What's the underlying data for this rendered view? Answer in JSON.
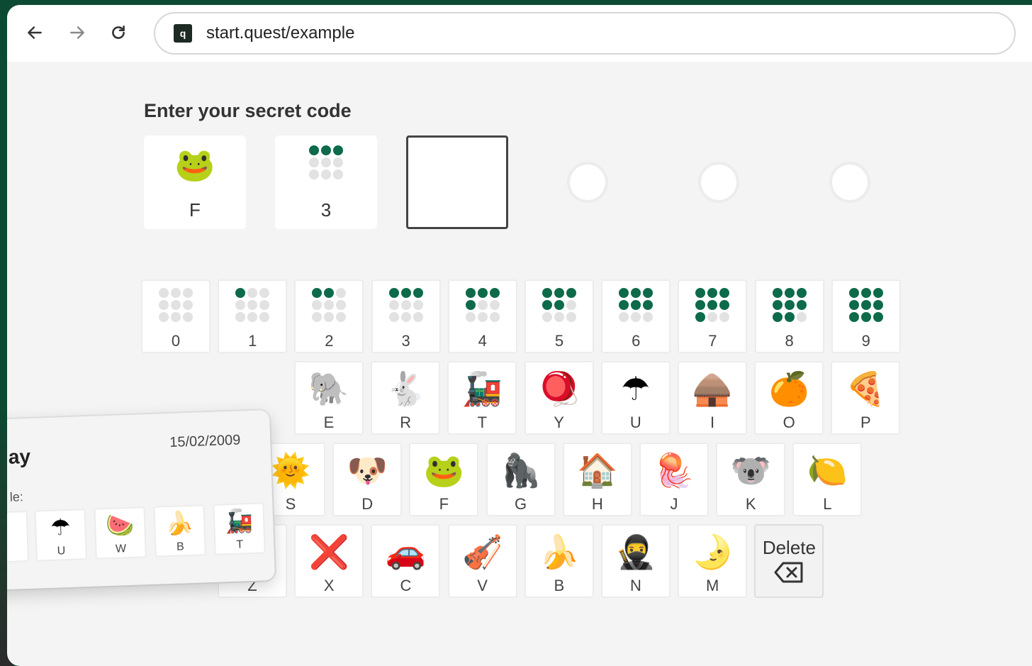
{
  "browser": {
    "url": "start.quest/example",
    "site_icon": "q"
  },
  "page": {
    "heading": "Enter your secret code",
    "code_slots": [
      {
        "type": "emoji",
        "glyph": "🐸",
        "label": "F",
        "icon": "frog-icon"
      },
      {
        "type": "dots",
        "count": 3,
        "label": "3"
      },
      {
        "type": "active",
        "label": ""
      },
      {
        "type": "empty"
      },
      {
        "type": "empty"
      },
      {
        "type": "empty"
      }
    ]
  },
  "keyboard": {
    "numbers": [
      "0",
      "1",
      "2",
      "3",
      "4",
      "5",
      "6",
      "7",
      "8",
      "9"
    ],
    "row1": [
      {
        "glyph": "🐘",
        "label": "E",
        "icon": "elephant-icon"
      },
      {
        "glyph": "🐇",
        "label": "R",
        "icon": "rabbit-icon"
      },
      {
        "glyph": "🚂",
        "label": "T",
        "icon": "train-icon"
      },
      {
        "glyph": "🪀",
        "label": "Y",
        "icon": "yoyo-icon"
      },
      {
        "glyph": "☂",
        "label": "U",
        "icon": "umbrella-icon"
      },
      {
        "glyph": "🛖",
        "label": "I",
        "icon": "igloo-icon"
      },
      {
        "glyph": "🍊",
        "label": "O",
        "icon": "orange-icon"
      },
      {
        "glyph": "🍕",
        "label": "P",
        "icon": "pizza-icon"
      }
    ],
    "row2": [
      {
        "glyph": "🌞",
        "label": "S",
        "icon": "sun-icon"
      },
      {
        "glyph": "🐶",
        "label": "D",
        "icon": "dog-icon"
      },
      {
        "glyph": "🐸",
        "label": "F",
        "icon": "frog-icon"
      },
      {
        "glyph": "🦍",
        "label": "G",
        "icon": "gorilla-icon"
      },
      {
        "glyph": "🏠",
        "label": "H",
        "icon": "house-icon"
      },
      {
        "glyph": "🪼",
        "label": "J",
        "icon": "jellyfish-icon"
      },
      {
        "glyph": "🐨",
        "label": "K",
        "icon": "koala-icon"
      },
      {
        "glyph": "🍋",
        "label": "L",
        "icon": "lemon-icon"
      }
    ],
    "row3": [
      {
        "glyph": "🦓",
        "label": "Z",
        "icon": "zebra-icon"
      },
      {
        "glyph": "❌",
        "label": "X",
        "icon": "x-mark-icon"
      },
      {
        "glyph": "🚗",
        "label": "C",
        "icon": "car-icon"
      },
      {
        "glyph": "🎻",
        "label": "V",
        "icon": "violin-icon"
      },
      {
        "glyph": "🍌",
        "label": "B",
        "icon": "banana-icon"
      },
      {
        "glyph": "🥷",
        "label": "N",
        "icon": "ninja-icon"
      },
      {
        "glyph": "🌛",
        "label": "M",
        "icon": "moon-icon"
      }
    ],
    "delete_label": "Delete"
  },
  "overlay_card": {
    "title_fragment": "ay",
    "date": "15/02/2009",
    "subtitle_fragment": "le:",
    "items": [
      {
        "glyph": "☂",
        "label": "U",
        "icon": "umbrella-icon"
      },
      {
        "glyph": "🍉",
        "label": "W",
        "icon": "watermelon-icon"
      },
      {
        "glyph": "🍌",
        "label": "B",
        "icon": "banana-icon"
      },
      {
        "glyph": "🚂",
        "label": "T",
        "icon": "train-icon"
      }
    ]
  },
  "colors": {
    "accent": "#0d6b4a",
    "background_frame": "#0d4a33",
    "page_bg": "#f4f4f4"
  }
}
